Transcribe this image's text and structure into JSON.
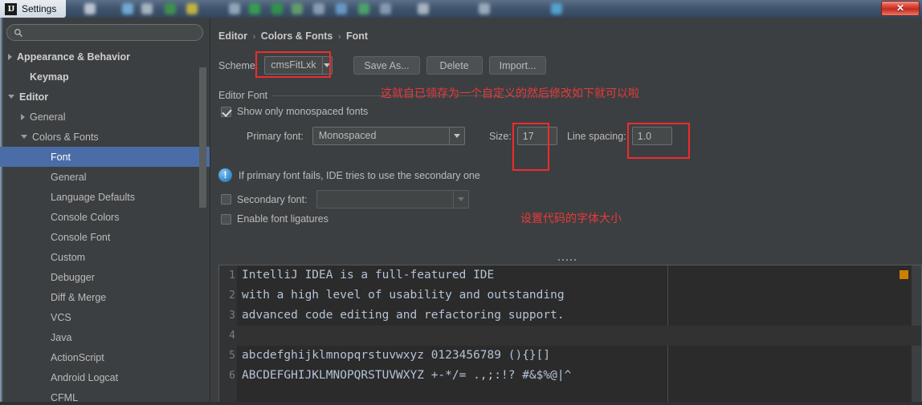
{
  "window": {
    "title": "Settings",
    "logo_text": "IJ",
    "close_label": "✕"
  },
  "search": {
    "value": "",
    "placeholder": ""
  },
  "sidebar": {
    "items": [
      {
        "label": "Appearance & Behavior",
        "indent": 10,
        "twisty": "right",
        "bold": true,
        "selected": false
      },
      {
        "label": "Keymap",
        "indent": 26,
        "twisty": "none",
        "bold": true,
        "selected": false
      },
      {
        "label": "Editor",
        "indent": 10,
        "twisty": "down",
        "bold": true,
        "selected": false
      },
      {
        "label": "General",
        "indent": 26,
        "twisty": "right",
        "bold": false,
        "selected": false
      },
      {
        "label": "Colors & Fonts",
        "indent": 26,
        "twisty": "down",
        "bold": false,
        "selected": false
      },
      {
        "label": "Font",
        "indent": 52,
        "twisty": "none",
        "bold": false,
        "selected": true
      },
      {
        "label": "General",
        "indent": 52,
        "twisty": "none",
        "bold": false,
        "selected": false
      },
      {
        "label": "Language Defaults",
        "indent": 52,
        "twisty": "none",
        "bold": false,
        "selected": false
      },
      {
        "label": "Console Colors",
        "indent": 52,
        "twisty": "none",
        "bold": false,
        "selected": false
      },
      {
        "label": "Console Font",
        "indent": 52,
        "twisty": "none",
        "bold": false,
        "selected": false
      },
      {
        "label": "Custom",
        "indent": 52,
        "twisty": "none",
        "bold": false,
        "selected": false
      },
      {
        "label": "Debugger",
        "indent": 52,
        "twisty": "none",
        "bold": false,
        "selected": false
      },
      {
        "label": "Diff & Merge",
        "indent": 52,
        "twisty": "none",
        "bold": false,
        "selected": false
      },
      {
        "label": "VCS",
        "indent": 52,
        "twisty": "none",
        "bold": false,
        "selected": false
      },
      {
        "label": "Java",
        "indent": 52,
        "twisty": "none",
        "bold": false,
        "selected": false
      },
      {
        "label": "ActionScript",
        "indent": 52,
        "twisty": "none",
        "bold": false,
        "selected": false
      },
      {
        "label": "Android Logcat",
        "indent": 52,
        "twisty": "none",
        "bold": false,
        "selected": false
      },
      {
        "label": "CFML",
        "indent": 52,
        "twisty": "none",
        "bold": false,
        "selected": false
      }
    ]
  },
  "breadcrumb": {
    "part1": "Editor",
    "part2": "Colors & Fonts",
    "part3": "Font",
    "separator": "›"
  },
  "scheme": {
    "label": "Scheme:",
    "value": "cmsFitLxk",
    "save_as": "Save As...",
    "delete": "Delete",
    "import": "Import..."
  },
  "editor_font": {
    "group_title": "Editor Font",
    "monospaced_label": "Show only monospaced fonts",
    "monospaced_checked": true,
    "primary_font_label": "Primary font:",
    "primary_font_value": "Monospaced",
    "size_label": "Size:",
    "size_value": "17",
    "line_spacing_label": "Line spacing:",
    "line_spacing_value": "1.0",
    "info_text": "If primary font fails, IDE tries to use the secondary one",
    "info_icon_glyph": "!",
    "secondary_font_label": "Secondary font:",
    "secondary_font_value": "",
    "secondary_checked": false,
    "ligatures_label": "Enable font ligatures",
    "ligatures_checked": false
  },
  "annotations": {
    "note_top": "这就自已领存为一个自定义的然后修改如下就可以啦",
    "note_bottom": "设置代码的字体大小",
    "color": "#e83a3a"
  },
  "preview": {
    "lines": [
      {
        "num": "1",
        "text": "IntelliJ IDEA is a full-featured IDE"
      },
      {
        "num": "2",
        "text": "with a high level of usability and outstanding"
      },
      {
        "num": "3",
        "text": "advanced code editing and refactoring support."
      },
      {
        "num": "4",
        "text": ""
      },
      {
        "num": "5",
        "text": "abcdefghijklmnopqrstuvwxyz 0123456789 (){}[]"
      },
      {
        "num": "6",
        "text": "ABCDEFGHIJKLMNOPQRSTUVWXYZ +-*/= .,;:!? #&$%@|^"
      }
    ]
  },
  "colors": {
    "selection_blue": "#4a6da7",
    "dialog_bg": "#3c3f41",
    "editor_bg": "#2b2b2b",
    "marker_orange": "#cd8000",
    "accent_red": "#ef2b2b"
  }
}
